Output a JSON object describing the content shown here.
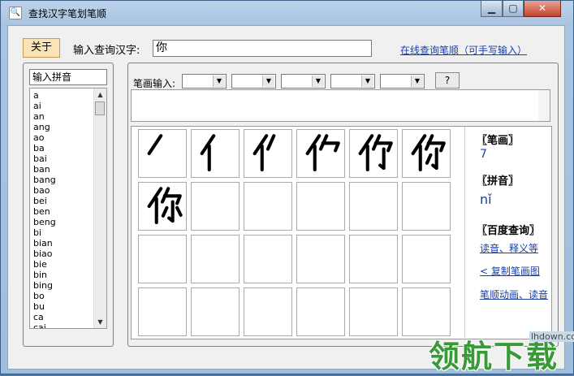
{
  "window": {
    "title": "查找汉字笔划笔顺",
    "minimize_glyph": "▁",
    "restore_glyph": "▢",
    "close_glyph": "✕"
  },
  "toolbar": {
    "about_label": "关于",
    "query_label": "输入查询汉字:",
    "query_value": "你",
    "online_link": "在线查询笔顺（可手写输入）"
  },
  "pinyin_panel": {
    "input_value": "输入拼音",
    "items": [
      "a",
      "ai",
      "an",
      "ang",
      "ao",
      "ba",
      "bai",
      "ban",
      "bang",
      "bao",
      "bei",
      "ben",
      "beng",
      "bi",
      "bian",
      "biao",
      "bie",
      "bin",
      "bing",
      "bo",
      "bu",
      "ca",
      "cai"
    ]
  },
  "stroke_input": {
    "label": "笔画输入:",
    "help_label": "?"
  },
  "info": {
    "stroke_heading": "〖笔画〗",
    "stroke_count": "7",
    "pinyin_heading": "〖拼音〗",
    "pinyin_value": "nǐ",
    "baidu_heading": "〖百度查询〗",
    "link_pronunciation": "读音、释义等",
    "link_copy": "< 复制笔画图",
    "link_animation": "笔顺动画、读音"
  },
  "watermark": {
    "domain": "lhdown.com",
    "brand": "领航下载"
  }
}
